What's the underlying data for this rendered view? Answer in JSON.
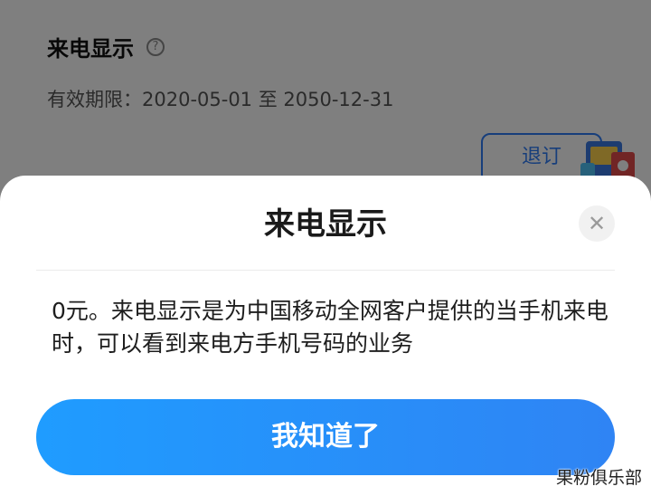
{
  "background": {
    "title": "来电显示",
    "help_icon": "question-circle-icon",
    "validity": "有效期限：2020-05-01 至 2050-12-31",
    "cancel_button": "退订"
  },
  "dialog": {
    "title": "来电显示",
    "close_icon": "close-icon",
    "description": "0元。来电显示是为中国移动全网客户提供的当手机来电时，可以看到来电方手机号码的业务",
    "confirm_button": "我知道了"
  },
  "watermark": "果粉俱乐部",
  "colors": {
    "accent": "#2f7cf6",
    "button_gradient_start": "#1f9cff",
    "button_gradient_end": "#2f84f4",
    "overlay": "rgba(0,0,0,0.5)"
  }
}
